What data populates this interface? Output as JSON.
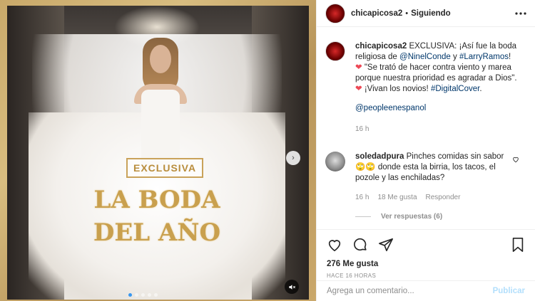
{
  "header": {
    "username": "chicapicosa2",
    "separator": "•",
    "follow_status": "Siguiendo",
    "more_icon": "more-horizontal-icon",
    "more_label": "..."
  },
  "caption": {
    "username": "chicapicosa2",
    "part1": "EXCLUSIVA: ¡Así fue la boda religiosa de ",
    "mention1": "@NinelConde",
    "part2": " y ",
    "hashtag1": "#LarryRamos",
    "part3": "! ",
    "heart1": "❤",
    "part4": " \"Se trató de hacer contra viento y marea porque nuestra prioridad es agradar a Dios\". ",
    "heart2": "❤",
    "part5": " ¡Vivan los novios! ",
    "hashtag2": "#DigitalCover",
    "part6": ".",
    "mention2": "@peopleenespanol",
    "time": "16 h"
  },
  "comment": {
    "username": "soledadpura",
    "text": "Pinches comidas sin sabor 🙄🙄 donde esta la birria, los tacos, el pozole y las enchiladas?",
    "time": "16 h",
    "likes": "18 Me gusta",
    "reply": "Responder",
    "view_replies": "Ver respuestas (6)"
  },
  "media": {
    "tag": "EXCLUSIVA",
    "headline_line1": "LA BODA",
    "headline_line2": "DEL AÑO",
    "next_icon": "chevron-right-icon",
    "next_glyph": "›",
    "mute_icon": "volume-muted-icon",
    "mute_glyph": "🔇",
    "slide_count": 5,
    "active_slide": 1
  },
  "actions": {
    "like_icon": "heart-icon",
    "comment_icon": "comment-icon",
    "share_icon": "share-icon",
    "save_icon": "bookmark-icon",
    "likes": "276 Me gusta",
    "ago": "HACE 16 HORAS"
  },
  "composer": {
    "placeholder": "Agrega un comentario...",
    "publish": "Publicar"
  },
  "colors": {
    "link": "#00376b",
    "heart": "#ed4956",
    "publish": "#b2dffc",
    "muted": "#8e8e8e",
    "gold": "#c9a04e"
  }
}
